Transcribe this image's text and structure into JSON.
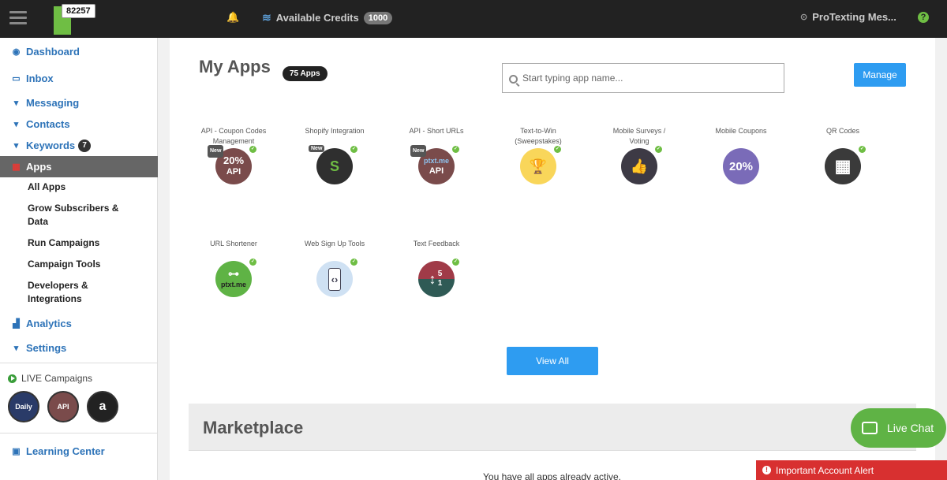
{
  "topbar": {
    "account_number": "82257",
    "credits_label": "Available Credits",
    "credits_value": "1000",
    "account_name": "ProTexting Mes...",
    "help_icon": "?"
  },
  "sidebar": {
    "dashboard": "Dashboard",
    "inbox": "Inbox",
    "messaging": "Messaging",
    "contacts": "Contacts",
    "keywords": "Keywords",
    "keywords_badge": "7",
    "apps": "Apps",
    "sub": {
      "all_apps": "All Apps",
      "grow_1": "Grow Subscribers &",
      "grow_2": "Data",
      "run": "Run Campaigns",
      "tools": "Campaign Tools",
      "dev_1": "Developers &",
      "dev_2": "Integrations"
    },
    "analytics": "Analytics",
    "settings": "Settings",
    "live_title": "LIVE Campaigns",
    "live": [
      "Daily",
      "API",
      "a"
    ],
    "learning": "Learning Center"
  },
  "main": {
    "title": "My Apps",
    "apps_count": "75  Apps",
    "search_placeholder": "Start typing app name...",
    "manage": "Manage",
    "view_all": "View All",
    "new_tag": "New",
    "apps": [
      {
        "l1": "API - Coupon Codes",
        "l2": "Management",
        "glyph": "20%",
        "glyph2": "API",
        "color": "#7a4b4b",
        "icon": "coupon-api-icon"
      },
      {
        "l1": "Shopify Integration",
        "l2": "",
        "glyph": "S",
        "glyph2": "",
        "color": "#2f2f2f",
        "icon": "shopify-bag-icon"
      },
      {
        "l1": "API - Short URLs",
        "l2": "",
        "glyph": "ptxt.me",
        "glyph2": "API",
        "color": "#7a4b4b",
        "icon": "short-url-api-icon"
      },
      {
        "l1": "Text-to-Win",
        "l2": "(Sweepstakes)",
        "glyph": "🏆",
        "glyph2": "",
        "color": "#f9d65a",
        "icon": "trophy-icon"
      },
      {
        "l1": "Mobile Surveys /",
        "l2": "Voting",
        "glyph": "👍",
        "glyph2": "",
        "color": "#3d3a45",
        "icon": "thumbs-up-icon"
      },
      {
        "l1": "Mobile Coupons",
        "l2": "",
        "glyph": "20%",
        "glyph2": "",
        "color": "#7a6bb8",
        "icon": "coupon-icon"
      },
      {
        "l1": "QR Codes",
        "l2": "",
        "glyph": "▦",
        "glyph2": "",
        "color": "#3a3a3a",
        "icon": "qr-code-icon"
      },
      {
        "l1": "URL Shortener",
        "l2": "",
        "glyph": "⊶",
        "glyph2": "ptxt.me",
        "color": "#5fb345",
        "icon": "link-icon"
      },
      {
        "l1": "Web Sign Up Tools",
        "l2": "",
        "glyph": "‹›",
        "glyph2": "",
        "color": "#cfe1f3",
        "icon": "web-signup-icon"
      },
      {
        "l1": "Text Feedback",
        "l2": "",
        "glyph": "↕",
        "glyph2": "5 1",
        "color": "#a03b48",
        "icon": "feedback-icon"
      }
    ]
  },
  "marketplace": {
    "title": "Marketplace",
    "note": "You have all apps already active."
  },
  "live_chat": "Live Chat",
  "alert": "Important Account Alert",
  "colors": {
    "accent": "#2e9cf1",
    "green": "#6fbe44",
    "alert": "#d83030"
  }
}
